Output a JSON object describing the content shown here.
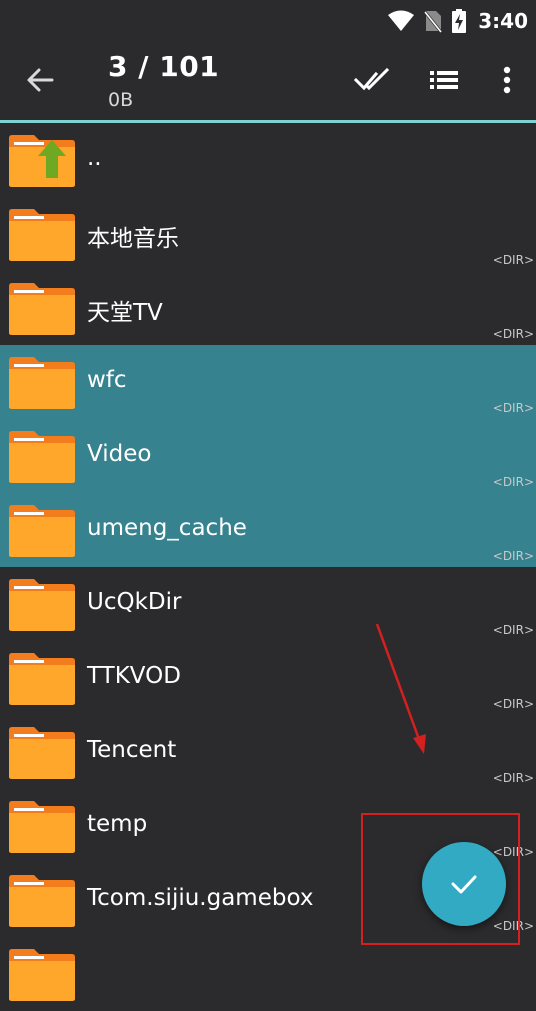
{
  "status_bar": {
    "time": "3:40"
  },
  "toolbar": {
    "count": "3 / 101",
    "size": "0B"
  },
  "items": [
    {
      "name": "..",
      "type": "",
      "selected": false,
      "up": true
    },
    {
      "name": "本地音乐",
      "type": "<DIR>",
      "selected": false
    },
    {
      "name": "天堂TV",
      "type": "<DIR>",
      "selected": false
    },
    {
      "name": "wfc",
      "type": "<DIR>",
      "selected": true
    },
    {
      "name": "Video",
      "type": "<DIR>",
      "selected": true
    },
    {
      "name": "umeng_cache",
      "type": "<DIR>",
      "selected": true
    },
    {
      "name": "UcQkDir",
      "type": "<DIR>",
      "selected": false
    },
    {
      "name": "TTKVOD",
      "type": "<DIR>",
      "selected": false
    },
    {
      "name": "Tencent",
      "type": "<DIR>",
      "selected": false
    },
    {
      "name": "temp",
      "type": "<DIR>",
      "selected": false
    },
    {
      "name": "Tcom.sijiu.gamebox",
      "type": "<DIR>",
      "selected": false
    },
    {
      "name": "",
      "type": "",
      "selected": false
    }
  ],
  "colors": {
    "background": "#2b2b2d",
    "selected_row": "#36838f",
    "accent_line": "#7fd3cf",
    "fab": "#33aac3",
    "folder": "#fea72a",
    "folder_tab": "#f37d1c",
    "annotation": "#d42020"
  },
  "icons": {
    "back": "arrow-left-icon",
    "select_all": "double-check-icon",
    "view": "list-view-icon",
    "more": "more-vert-icon",
    "fab": "check-icon"
  }
}
